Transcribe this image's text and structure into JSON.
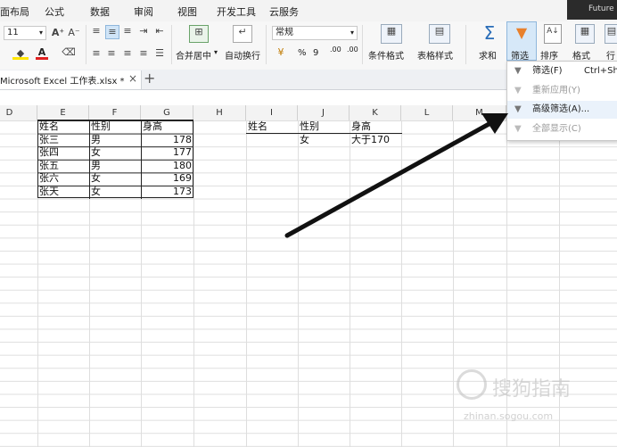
{
  "menubar": {
    "items": [
      "面布局",
      "公式",
      "数据",
      "审阅",
      "视图",
      "开发工具",
      "云服务"
    ],
    "user": "Future"
  },
  "ribbon": {
    "font_size": "11",
    "font_size_inc": "A⁺",
    "font_size_dec": "A⁻",
    "merge_center": "合并居中",
    "wrap_text": "自动换行",
    "number_format": "常规",
    "percent": "%",
    "comma": "9",
    "dec_inc": ".00",
    "dec_dec": ".00",
    "cond_format": "条件格式",
    "table_style": "表格样式",
    "sum": "求和",
    "filter": "筛选",
    "sort": "排序",
    "format": "格式",
    "rowcol": "行"
  },
  "tabs": {
    "file": "Microsoft Excel 工作表.xlsx *",
    "close": "×",
    "add": "+"
  },
  "columns": [
    "D",
    "E",
    "F",
    "G",
    "H",
    "I",
    "J",
    "K",
    "L",
    "M"
  ],
  "table1": {
    "headers": [
      "姓名",
      "性别",
      "身高"
    ],
    "rows": [
      [
        "张三",
        "男",
        "178"
      ],
      [
        "张四",
        "女",
        "177"
      ],
      [
        "张五",
        "男",
        "180"
      ],
      [
        "张六",
        "女",
        "169"
      ],
      [
        "张天",
        "女",
        "173"
      ]
    ]
  },
  "criteria": {
    "headers": [
      "姓名",
      "性别",
      "身高"
    ],
    "values": [
      "",
      "女",
      "大于170"
    ]
  },
  "dropdown": {
    "items": [
      {
        "label": "筛选(F)",
        "shortcut": "Ctrl+Shi",
        "enabled": true
      },
      {
        "label": "重新应用(Y)",
        "shortcut": "",
        "enabled": false
      },
      {
        "label": "高级筛选(A)...",
        "shortcut": "",
        "enabled": true
      },
      {
        "label": "全部显示(C)",
        "shortcut": "",
        "enabled": false
      }
    ]
  },
  "watermark": {
    "brand": "搜狗指南",
    "url": "zhinan.sogou.com"
  },
  "colors": {
    "accent": "#2a6db8",
    "filter_icon": "#e8802c",
    "arrow": "#111111"
  }
}
